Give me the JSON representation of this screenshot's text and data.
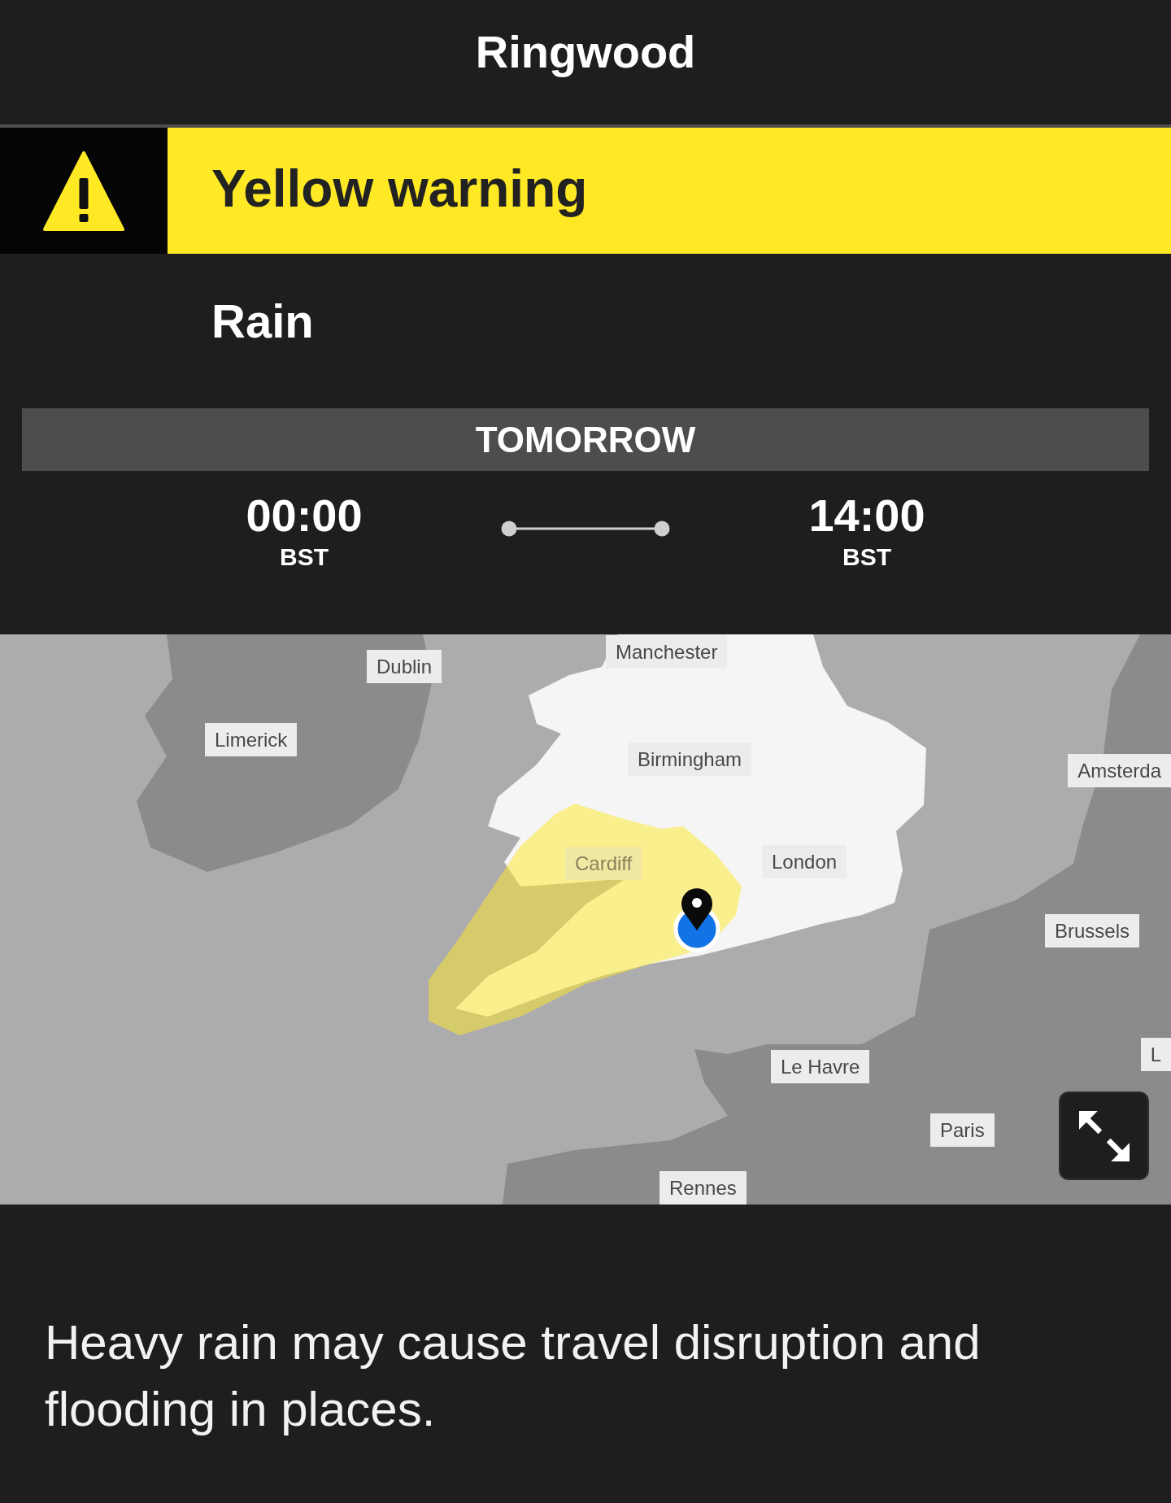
{
  "header": {
    "title": "Ringwood"
  },
  "warning": {
    "kind": "yellow",
    "title": "Yellow warning",
    "type": "Rain"
  },
  "period": {
    "day": "TOMORROW",
    "start": {
      "time": "00:00",
      "zone": "BST"
    },
    "end": {
      "time": "14:00",
      "zone": "BST"
    }
  },
  "map": {
    "labels": [
      {
        "text": "Manchester",
        "in_warning_area": false
      },
      {
        "text": "Dublin",
        "in_warning_area": false
      },
      {
        "text": "Limerick",
        "in_warning_area": false
      },
      {
        "text": "Birmingham",
        "in_warning_area": false
      },
      {
        "text": "Amsterda",
        "in_warning_area": false
      },
      {
        "text": "Cardiff",
        "in_warning_area": true
      },
      {
        "text": "London",
        "in_warning_area": false
      },
      {
        "text": "Brussels",
        "in_warning_area": false
      },
      {
        "text": "L",
        "in_warning_area": false
      },
      {
        "text": "Le Havre",
        "in_warning_area": false
      },
      {
        "text": "Paris",
        "in_warning_area": false
      },
      {
        "text": "Rennes",
        "in_warning_area": false
      }
    ]
  },
  "description": "Heavy rain may cause travel disruption and flooding in places."
}
